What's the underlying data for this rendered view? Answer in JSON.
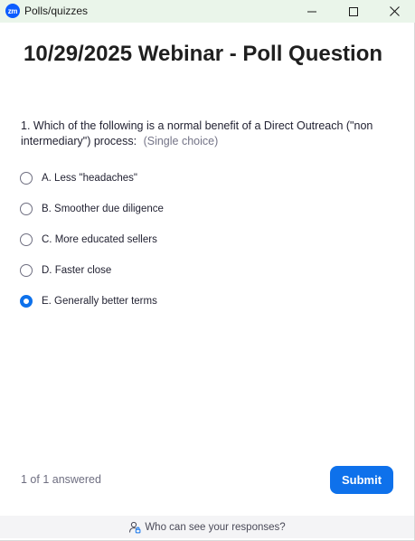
{
  "window": {
    "logo_text": "zm",
    "title": "Polls/quizzes"
  },
  "poll": {
    "title": "10/29/2025 Webinar - Poll Question",
    "question": "1. Which of the following is a normal benefit of a Direct Outreach (\"non intermediary\") process:",
    "question_type": "(Single choice)",
    "options": [
      {
        "label": "A. Less \"headaches\"",
        "selected": false
      },
      {
        "label": "B. Smoother due diligence",
        "selected": false
      },
      {
        "label": "C. More educated sellers",
        "selected": false
      },
      {
        "label": "D. Faster close",
        "selected": false
      },
      {
        "label": "E. Generally better terms",
        "selected": true
      }
    ]
  },
  "footer": {
    "answered": "1 of 1 answered",
    "submit_label": "Submit",
    "privacy_text": "Who can see your responses?"
  },
  "colors": {
    "accent": "#0e71eb",
    "titlebar_bg": "#eaf5ea",
    "brand": "#0b5cff"
  }
}
